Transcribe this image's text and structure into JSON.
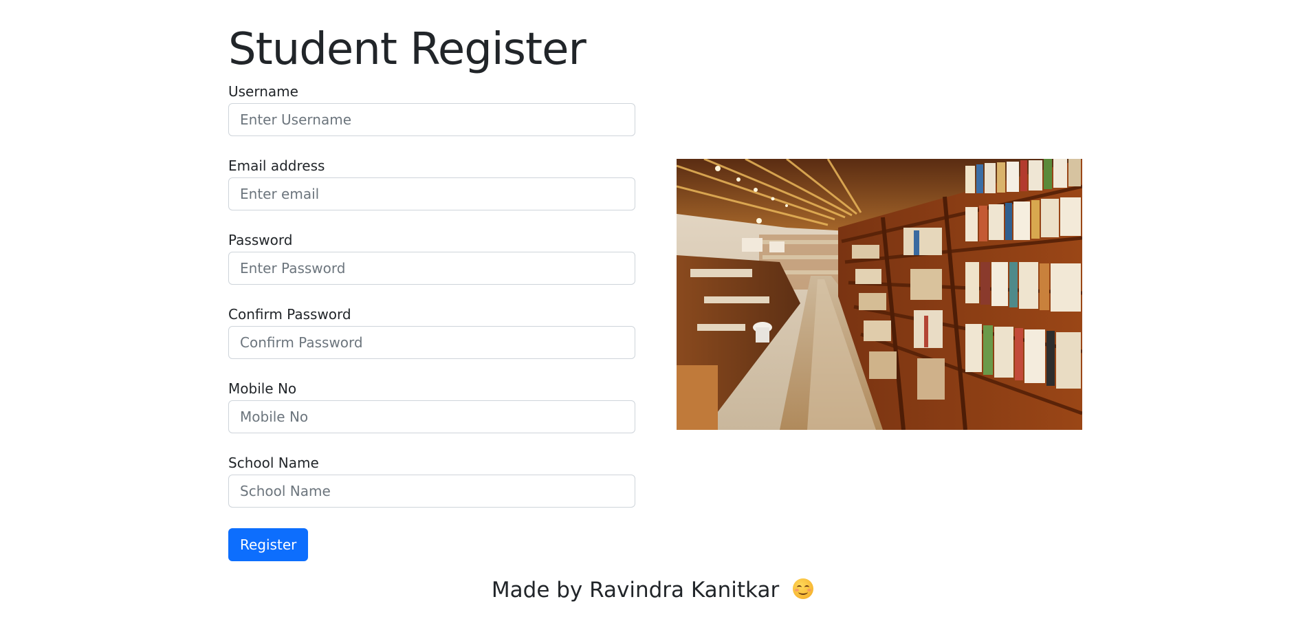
{
  "page": {
    "title": "Student Register"
  },
  "form": {
    "fields": [
      {
        "label": "Username",
        "placeholder": "Enter Username",
        "value": ""
      },
      {
        "label": "Email address",
        "placeholder": "Enter email",
        "value": ""
      },
      {
        "label": "Password",
        "placeholder": "Enter Password",
        "value": ""
      },
      {
        "label": "Confirm Password",
        "placeholder": "Confirm Password",
        "value": ""
      },
      {
        "label": "Mobile No",
        "placeholder": "Mobile No",
        "value": ""
      },
      {
        "label": "School Name",
        "placeholder": "School Name",
        "value": ""
      }
    ],
    "submit_label": "Register"
  },
  "footer": {
    "text": "Made by Ravindra Kanitkar",
    "emoji": "smiling-face-icon"
  },
  "image": {
    "subject": "library-bookshelves-photo"
  },
  "colors": {
    "primary": "#0d6efd",
    "text": "#212529",
    "placeholder": "#6c757d",
    "input_border": "#ced4da"
  }
}
